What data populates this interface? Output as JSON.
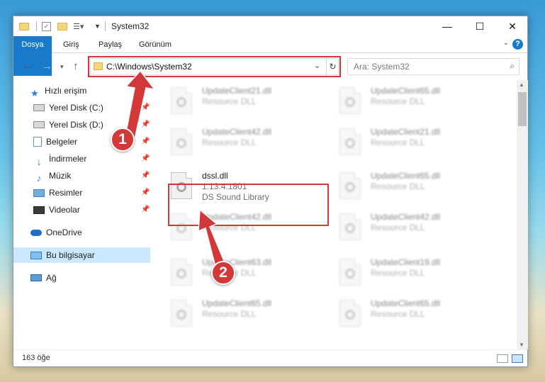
{
  "window": {
    "title": "System32",
    "controls": {
      "minimize": "—",
      "maximize": "☐",
      "close": "✕"
    }
  },
  "ribbon": {
    "tabs": [
      "Dosya",
      "Giriş",
      "Paylaş",
      "Görünüm"
    ],
    "help": "?",
    "accent_color": "#1979ca"
  },
  "address": {
    "path": "C:\\Windows\\System32",
    "search_placeholder": "Ara: System32"
  },
  "nav": {
    "quick_access": "Hızlı erişim",
    "items": [
      {
        "label": "Yerel Disk (C:)",
        "icon": "drive-icon"
      },
      {
        "label": "Yerel Disk (D:)",
        "icon": "drive-icon"
      },
      {
        "label": "Belgeler",
        "icon": "documents-icon"
      },
      {
        "label": "İndirmeler",
        "icon": "download-icon"
      },
      {
        "label": "Müzik",
        "icon": "music-icon"
      },
      {
        "label": "Resimler",
        "icon": "pictures-icon"
      },
      {
        "label": "Videolar",
        "icon": "videos-icon"
      }
    ],
    "onedrive": "OneDrive",
    "this_pc": "Bu bilgisayar",
    "network": "Ağ"
  },
  "files": {
    "left": [
      {
        "name": "UpdateClient21.dll",
        "desc": "Resource DLL"
      },
      {
        "name": "UpdateClient42.dll",
        "desc": "Resource DLL"
      },
      {
        "name": "dssl.dll",
        "version": "1.13.4.1801",
        "desc": "DS Sound Library"
      },
      {
        "name": "UpdateClient42.dll",
        "desc": "Resource DLL"
      },
      {
        "name": "UpdateClient63.dll",
        "desc": "Resource DLL"
      },
      {
        "name": "UpdateClient65.dll",
        "desc": "Resource DLL"
      }
    ],
    "right": [
      {
        "name": "UpdateClient65.dll",
        "desc": "Resource DLL"
      },
      {
        "name": "UpdateClient21.dll",
        "desc": "Resource DLL"
      },
      {
        "name": "UpdateClient65.dll",
        "desc": "Resource DLL"
      },
      {
        "name": "UpdateClient42.dll",
        "desc": "Resource DLL"
      },
      {
        "name": "UpdateClient19.dll",
        "desc": "Resource DLL"
      },
      {
        "name": "UpdateClient65.dll",
        "desc": "Resource DLL"
      }
    ]
  },
  "status": {
    "count": "163 öğe"
  },
  "annotations": {
    "step1": "1",
    "step2": "2",
    "highlight_color": "#d23838"
  }
}
